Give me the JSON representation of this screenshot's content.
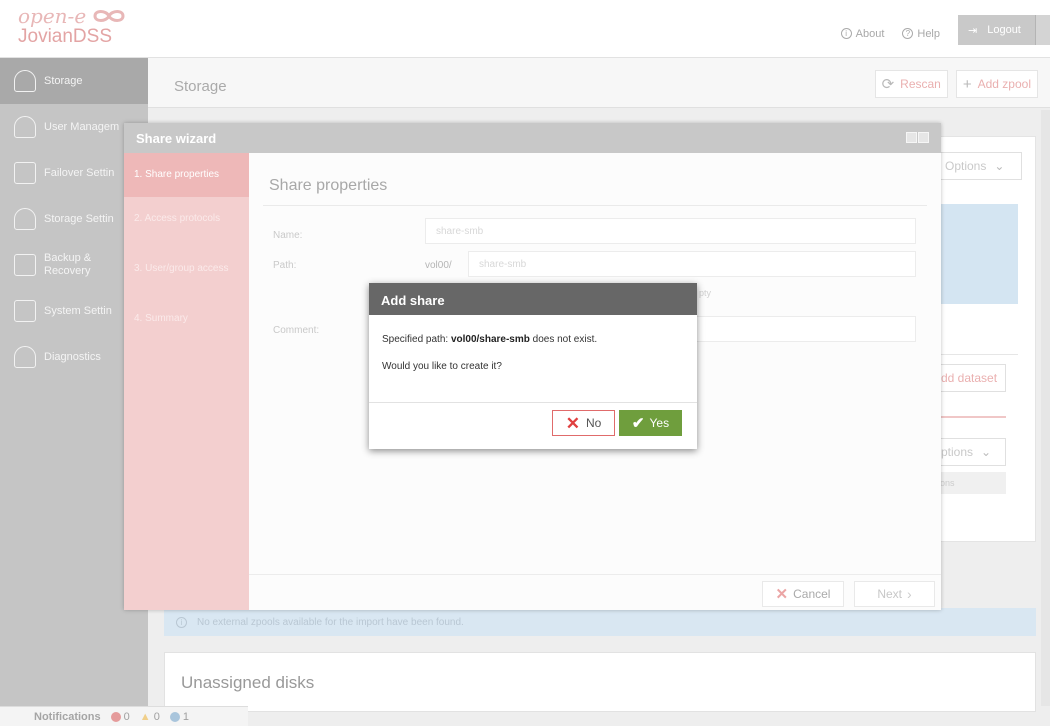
{
  "brand": {
    "logo_top": "open-e",
    "logo_bottom": "JovianDSS"
  },
  "topnav": {
    "about": "About",
    "help": "Help",
    "logout": "Logout"
  },
  "sidebar": {
    "items": [
      {
        "label": "Storage"
      },
      {
        "label": "User Managem"
      },
      {
        "label": "Failover Settin"
      },
      {
        "label": "Storage Settin"
      },
      {
        "label": "Backup &\nRecovery"
      },
      {
        "label": "System Settin"
      },
      {
        "label": "Diagnostics"
      }
    ]
  },
  "main": {
    "title": "Storage",
    "rescan": "Rescan",
    "add_zpool": "Add zpool",
    "options": "Options",
    "add_dataset": "dd dataset",
    "options2": "ptions",
    "ons": "ons",
    "info_text": "No external zpools available for the import have been found.",
    "unassigned": "Unassigned disks"
  },
  "notifications": {
    "label": "Notifications",
    "errors": "0",
    "warnings": "0",
    "info": "1"
  },
  "wizard": {
    "title": "Share wizard",
    "steps": [
      "1. Share properties",
      "2. Access protocols",
      "3. User/group access",
      "4. Summary"
    ],
    "heading": "Share properties",
    "name_label": "Name:",
    "name_value": "share-smb",
    "path_label": "Path:",
    "path_prefix": "vol00/",
    "path_value": "share-smb",
    "hint": "pty",
    "comment_label": "Comment:",
    "cancel": "Cancel",
    "next": "Next"
  },
  "dialog": {
    "title": "Add share",
    "msg_prefix": "Specified path: ",
    "msg_path": "vol00/share-smb",
    "msg_suffix": " does not exist.",
    "question": "Would you like to create it?",
    "no": "No",
    "yes": "Yes"
  }
}
